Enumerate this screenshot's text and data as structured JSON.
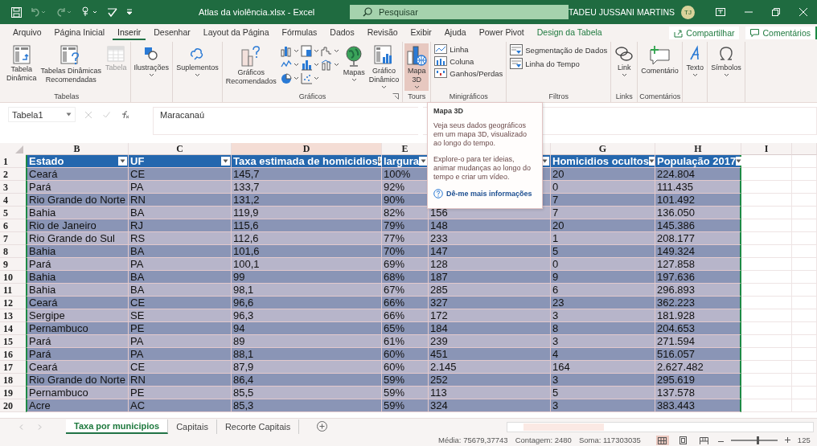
{
  "title_bar": {
    "file_title": "Atlas da violência.xlsx  -  Excel",
    "search_placeholder": "Pesquisar",
    "user_name": "TADEU JUSSANI MARTINS",
    "user_initials": "TJ"
  },
  "menu_tabs": [
    {
      "label": "Arquivo",
      "selected": false,
      "kind": "normal"
    },
    {
      "label": "Página Inicial",
      "selected": false,
      "kind": "normal"
    },
    {
      "label": "Inserir",
      "selected": true,
      "kind": "normal"
    },
    {
      "label": "Desenhar",
      "selected": false,
      "kind": "normal"
    },
    {
      "label": "Layout da Página",
      "selected": false,
      "kind": "normal"
    },
    {
      "label": "Fórmulas",
      "selected": false,
      "kind": "normal"
    },
    {
      "label": "Dados",
      "selected": false,
      "kind": "normal"
    },
    {
      "label": "Revisão",
      "selected": false,
      "kind": "normal"
    },
    {
      "label": "Exibir",
      "selected": false,
      "kind": "normal"
    },
    {
      "label": "Ajuda",
      "selected": false,
      "kind": "normal"
    },
    {
      "label": "Power Pivot",
      "selected": false,
      "kind": "normal"
    },
    {
      "label": "Design da Tabela",
      "selected": false,
      "kind": "contextual"
    }
  ],
  "share_button": "Compartilhar",
  "comments_button": "Comentários",
  "ribbon_groups": [
    {
      "label": "Tabelas",
      "commands": [
        {
          "label": "Tabela\nDinâmica",
          "kind": "large",
          "dropdown": false,
          "disabled": false
        },
        {
          "label": "Tabelas Dinâmicas\nRecomendadas",
          "kind": "large",
          "dropdown": false,
          "disabled": false
        },
        {
          "label": "Tabela",
          "kind": "large",
          "dropdown": false,
          "disabled": true
        }
      ]
    },
    {
      "commands": [
        {
          "label": "Ilustrações",
          "kind": "large",
          "dropdown": true
        }
      ]
    },
    {
      "commands": [
        {
          "label": "Suplementos",
          "kind": "large",
          "dropdown": true
        }
      ]
    },
    {
      "label": "Gráficos",
      "launcher": true,
      "commands": [
        {
          "label": "Gráficos\nRecomendados",
          "kind": "large",
          "dropdown": false
        },
        {
          "kind": "gallery"
        },
        {
          "label": "Mapas",
          "kind": "large",
          "dropdown": true
        },
        {
          "label": "Gráfico\nDinâmico",
          "kind": "large",
          "dropdown": true
        }
      ]
    },
    {
      "label": "Tours",
      "commands": [
        {
          "label": "Mapa\n3D",
          "kind": "large",
          "dropdown": true,
          "highlighted": true
        }
      ]
    },
    {
      "label": "Minigráficos",
      "commands": [
        {
          "label": "Linha",
          "kind": "small"
        },
        {
          "label": "Coluna",
          "kind": "small"
        },
        {
          "label": "Ganhos/Perdas",
          "kind": "small"
        }
      ]
    },
    {
      "label": "Filtros",
      "commands": [
        {
          "label": "Segmentação de Dados",
          "kind": "small"
        },
        {
          "label": "Linha do Tempo",
          "kind": "small"
        }
      ]
    },
    {
      "label": "Links",
      "commands": [
        {
          "label": "Link",
          "kind": "large",
          "dropdown": true
        }
      ]
    },
    {
      "label": "Comentários",
      "commands": [
        {
          "label": "Comentário",
          "kind": "large",
          "dropdown": false
        }
      ]
    },
    {
      "commands": [
        {
          "label": "Texto",
          "kind": "large",
          "dropdown": true
        }
      ]
    },
    {
      "commands": [
        {
          "label": "Símbolos",
          "kind": "large",
          "dropdown": true
        }
      ]
    }
  ],
  "formula_bar": {
    "name_box": "Tabela1",
    "formula": "Maracanaú"
  },
  "tooltip": {
    "title": "Mapa 3D",
    "paragraphs": [
      "Veja seus dados geográficos em um mapa 3D, visualizado ao longo do tempo.",
      "Explore-o para ter ideias, animar mudanças ao longo do tempo e criar um vídeo."
    ],
    "link": "Dê-me mais informações"
  },
  "table": {
    "columns": [
      {
        "letter": "B",
        "header": "Estado",
        "kind": "filter",
        "selected": false
      },
      {
        "letter": "C",
        "header": "UF",
        "kind": "filter",
        "selected": false
      },
      {
        "letter": "D",
        "header": "Taxa estimada de homicidios",
        "kind": "sort",
        "selected": true
      },
      {
        "letter": "E",
        "header": "largura",
        "kind": "filter",
        "selected": false
      },
      {
        "kind": "filter",
        "selected": false
      },
      {
        "letter": "G",
        "header": "Homicidios ocultos",
        "kind": "filter",
        "selected": false
      },
      {
        "letter": "H",
        "header": "População 2017",
        "kind": "filter",
        "selected": false
      },
      {
        "letter": "I",
        "selected": false
      }
    ],
    "header_row": "1",
    "rows": [
      {
        "number": "2",
        "cells": [
          "Ceará",
          "CE",
          "145,7",
          "100%",
          null,
          "20",
          "224.804"
        ]
      },
      {
        "number": "3",
        "cells": [
          "Pará",
          "PA",
          "133,7",
          "92%",
          null,
          "0",
          "111.435"
        ]
      },
      {
        "number": "4",
        "cells": [
          "Rio Grande do Norte",
          "RN",
          "131,2",
          "90%",
          null,
          "7",
          "101.492"
        ]
      },
      {
        "number": "5",
        "cells": [
          "Bahia",
          "BA",
          "119,9",
          "82%",
          "156",
          "7",
          "136.050"
        ]
      },
      {
        "number": "6",
        "cells": [
          "Rio de Janeiro",
          "RJ",
          "115,6",
          "79%",
          "148",
          "20",
          "145.386"
        ]
      },
      {
        "number": "7",
        "cells": [
          "Rio Grande do Sul",
          "RS",
          "112,6",
          "77%",
          "233",
          "1",
          "208.177"
        ]
      },
      {
        "number": "8",
        "cells": [
          "Bahia",
          "BA",
          "101,6",
          "70%",
          "147",
          "5",
          "149.324"
        ]
      },
      {
        "number": "9",
        "cells": [
          "Pará",
          "PA",
          "100,1",
          "69%",
          "128",
          "0",
          "127.858"
        ]
      },
      {
        "number": "10",
        "cells": [
          "Bahia",
          "BA",
          "99",
          "68%",
          "187",
          "9",
          "197.636"
        ]
      },
      {
        "number": "11",
        "cells": [
          "Bahia",
          "BA",
          "98,1",
          "67%",
          "285",
          "6",
          "296.893"
        ]
      },
      {
        "number": "12",
        "cells": [
          "Ceará",
          "CE",
          "96,6",
          "66%",
          "327",
          "23",
          "362.223"
        ]
      },
      {
        "number": "13",
        "cells": [
          "Sergipe",
          "SE",
          "96,3",
          "66%",
          "172",
          "3",
          "181.928"
        ]
      },
      {
        "number": "14",
        "cells": [
          "Pernambuco",
          "PE",
          "94",
          "65%",
          "184",
          "8",
          "204.653"
        ]
      },
      {
        "number": "15",
        "cells": [
          "Pará",
          "PA",
          "89",
          "61%",
          "239",
          "3",
          "271.594"
        ]
      },
      {
        "number": "16",
        "cells": [
          "Pará",
          "PA",
          "88,1",
          "60%",
          "451",
          "4",
          "516.057"
        ]
      },
      {
        "number": "17",
        "cells": [
          "Ceará",
          "CE",
          "87,9",
          "60%",
          "2.145",
          "164",
          "2.627.482"
        ]
      },
      {
        "number": "18",
        "cells": [
          "Rio Grande do Norte",
          "RN",
          "86,4",
          "59%",
          "252",
          "3",
          "295.619"
        ]
      },
      {
        "number": "19",
        "cells": [
          "Pernambuco",
          "PE",
          "85,5",
          "59%",
          "113",
          "5",
          "137.578"
        ]
      },
      {
        "number": "20",
        "cells": [
          "Acre",
          "AC",
          "85,3",
          "59%",
          "324",
          "3",
          "383.443"
        ]
      }
    ]
  },
  "sheet_tabs": [
    {
      "label": "Taxa por municipios",
      "selected": true
    },
    {
      "label": "Capitais",
      "selected": false
    },
    {
      "label": "Recorte Capitais",
      "selected": false
    }
  ],
  "status_bar": {
    "stats": [
      "Média: 75679,37743",
      "Contagem: 2480",
      "Soma: 117303035"
    ],
    "views": [
      {
        "selected": true
      },
      {
        "selected": false
      },
      {
        "selected": false
      }
    ],
    "zoom": {
      "level": 0.55
    },
    "zoom_label": "125"
  }
}
